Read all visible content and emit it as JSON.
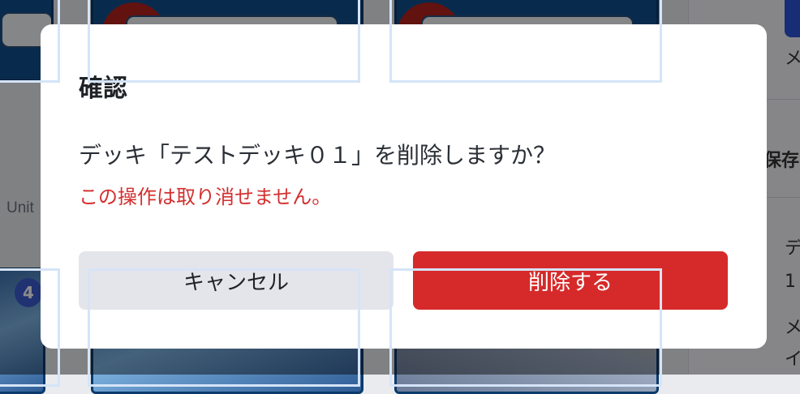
{
  "background": {
    "left_label": "Unit",
    "badge_number": "4",
    "right_texts": [
      "メ",
      "保存",
      "デ",
      "1",
      "メ",
      "イ"
    ]
  },
  "dialog": {
    "title": "確認",
    "message": "デッキ「テストデッキ０１」を削除しますか？",
    "warning": "この操作は取り消せません。",
    "cancel_label": "キャンセル",
    "delete_label": "削除する"
  },
  "colors": {
    "danger": "#d62a2a",
    "warning_text": "#d32f2f",
    "cancel_bg": "#e4e5ea"
  }
}
